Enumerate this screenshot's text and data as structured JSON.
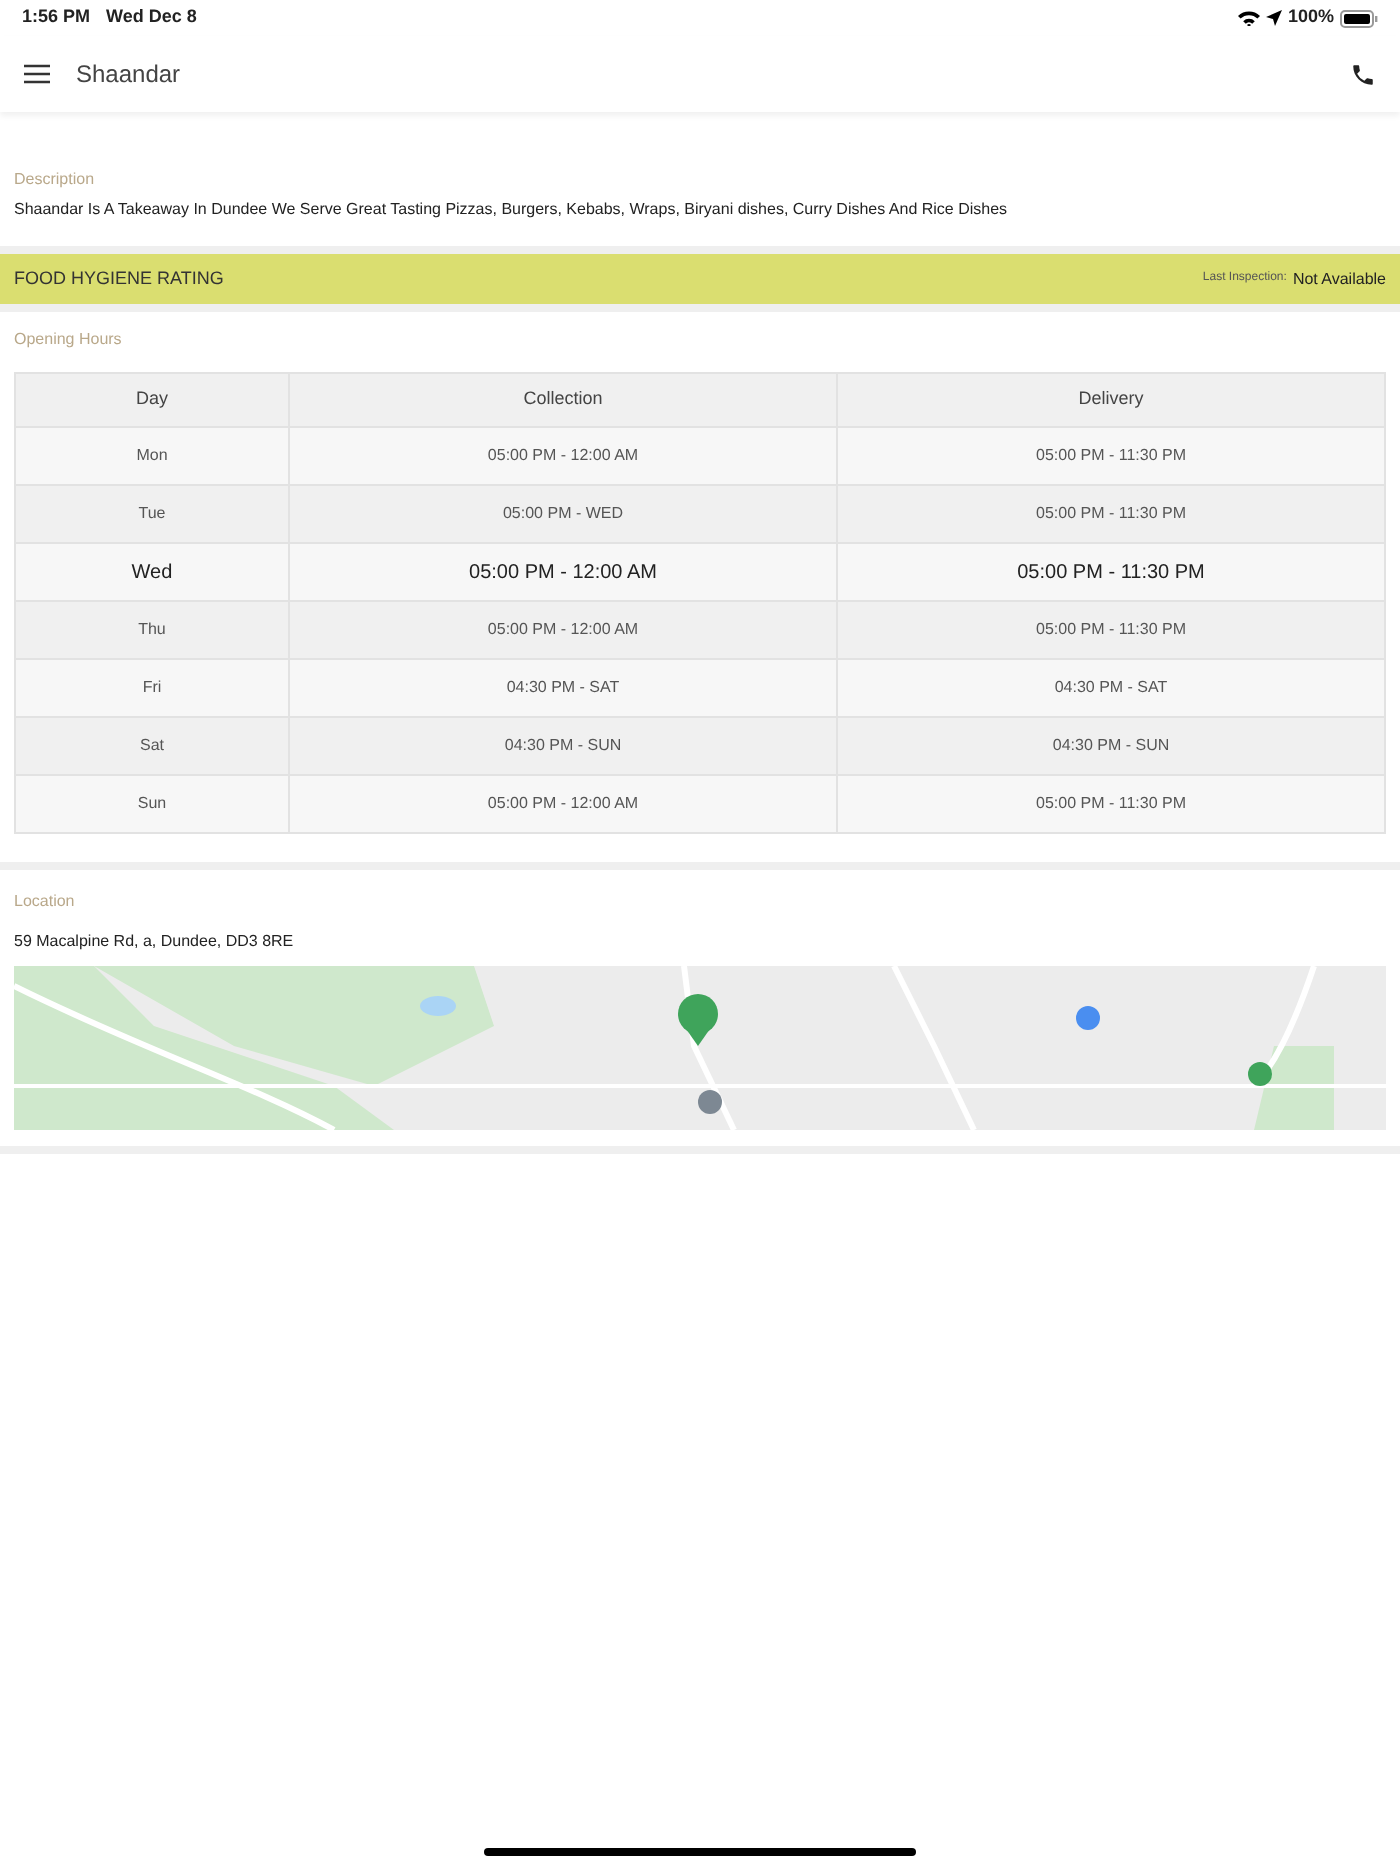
{
  "status_bar": {
    "time": "1:56 PM",
    "date": "Wed Dec 8",
    "battery_text": "100%"
  },
  "nav": {
    "title": "Shaandar"
  },
  "description": {
    "label": "Description",
    "text": "Shaandar Is A Takeaway In Dundee We Serve Great Tasting Pizzas, Burgers, Kebabs, Wraps, Biryani dishes, Curry Dishes And Rice Dishes"
  },
  "hygiene": {
    "title": "FOOD HYGIENE RATING",
    "inspection_label": "Last Inspection:",
    "inspection_value": "Not Available"
  },
  "opening_hours": {
    "label": "Opening Hours",
    "columns": [
      "Day",
      "Collection",
      "Delivery"
    ],
    "rows": [
      {
        "day": "Mon",
        "collection": "05:00 PM - 12:00 AM",
        "delivery": "05:00 PM - 11:30 PM",
        "selected": false
      },
      {
        "day": "Tue",
        "collection": "05:00 PM - WED",
        "delivery": "05:00 PM - 11:30 PM",
        "selected": false
      },
      {
        "day": "Wed",
        "collection": "05:00 PM - 12:00 AM",
        "delivery": "05:00 PM - 11:30 PM",
        "selected": true
      },
      {
        "day": "Thu",
        "collection": "05:00 PM - 12:00 AM",
        "delivery": "05:00 PM - 11:30 PM",
        "selected": false
      },
      {
        "day": "Fri",
        "collection": "04:30 PM - SAT",
        "delivery": "04:30 PM - SAT",
        "selected": false
      },
      {
        "day": "Sat",
        "collection": "04:30 PM - SUN",
        "delivery": "04:30 PM - SUN",
        "selected": false
      },
      {
        "day": "Sun",
        "collection": "05:00 PM - 12:00 AM",
        "delivery": "05:00 PM - 11:30 PM",
        "selected": false
      }
    ]
  },
  "location": {
    "label": "Location",
    "address": "59 Macalpine Rd, a, Dundee, DD3 8RE"
  }
}
